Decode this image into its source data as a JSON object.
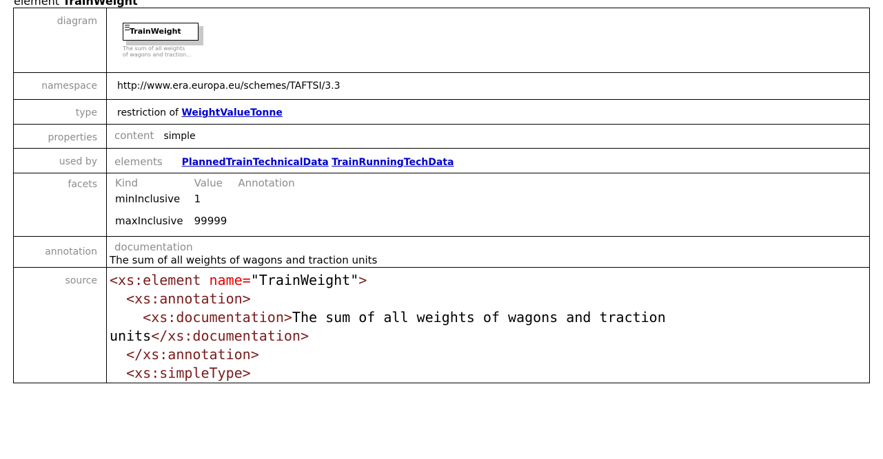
{
  "heading": {
    "prefix": "element",
    "name": "TrainWeight"
  },
  "rows": {
    "diagram": {
      "label": "diagram",
      "box_name": "TrainWeight",
      "doc_line1": "The sum of all weights",
      "doc_line2": "of wagons and traction..."
    },
    "namespace": {
      "label": "namespace",
      "value": "http://www.era.europa.eu/schemes/TAFTSI/3.3"
    },
    "type": {
      "label": "type",
      "prefix": "restriction of",
      "link": "WeightValueTonne"
    },
    "properties": {
      "label": "properties",
      "sub_label": "content",
      "value": "simple"
    },
    "used_by": {
      "label": "used by",
      "sub_label": "elements",
      "links": [
        "PlannedTrainTechnicalData",
        "TrainRunningTechData"
      ]
    },
    "facets": {
      "label": "facets",
      "headers": [
        "Kind",
        "Value",
        "Annotation"
      ],
      "items": [
        {
          "kind": "minInclusive",
          "value": "1",
          "annotation": ""
        },
        {
          "kind": "maxInclusive",
          "value": "99999",
          "annotation": ""
        }
      ]
    },
    "annotation": {
      "label": "annotation",
      "sub_label": "documentation",
      "text": "The sum of all weights of wagons and traction units"
    },
    "source": {
      "label": "source",
      "lines": [
        {
          "indent": "",
          "open": "<xs:element ",
          "attr": "name=",
          "val": "\"TrainWeight\"",
          "close": ">",
          "text": "",
          "end": ""
        },
        {
          "indent": "  ",
          "open": "<xs:annotation>",
          "attr": "",
          "val": "",
          "close": "",
          "text": "",
          "end": ""
        },
        {
          "indent": "    ",
          "open": "<xs:documentation>",
          "attr": "",
          "val": "",
          "close": "",
          "text": "The sum of all weights of wagons and traction",
          "end": ""
        },
        {
          "indent": "",
          "open": "",
          "attr": "",
          "val": "",
          "close": "",
          "text": "units",
          "end": "</xs:documentation>"
        },
        {
          "indent": "  ",
          "open": "</xs:annotation>",
          "attr": "",
          "val": "",
          "close": "",
          "text": "",
          "end": ""
        },
        {
          "indent": "  ",
          "open": "<xs:simpleType>",
          "attr": "",
          "val": "",
          "close": "",
          "text": "",
          "end": ""
        }
      ]
    }
  },
  "colors": {
    "label": "#8c8c8c",
    "link": "#0000cc",
    "tag": "#7a1b1b",
    "attr": "#e00000"
  }
}
